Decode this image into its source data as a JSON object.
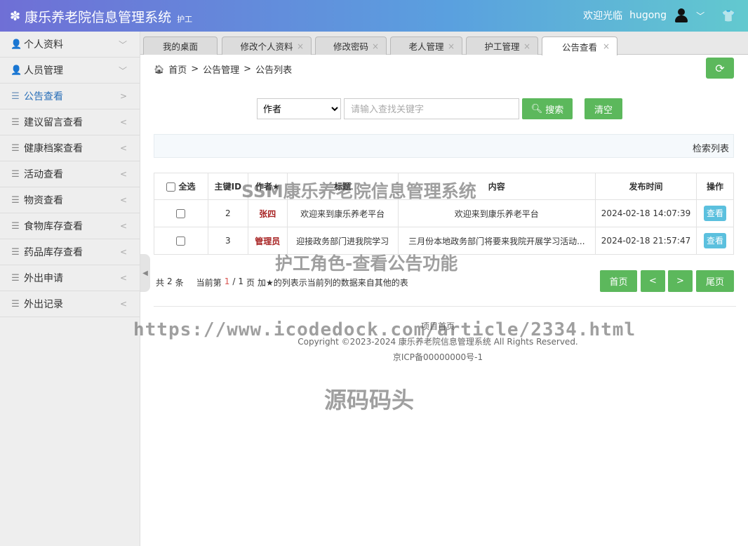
{
  "header": {
    "title": "康乐养老院信息管理系统",
    "role": "护工",
    "welcome": "欢迎光临",
    "username": "hugong"
  },
  "sidebar": {
    "items": [
      {
        "label": "个人资料",
        "icon": "user-icon",
        "arrow": "﹀"
      },
      {
        "label": "人员管理",
        "icon": "user-icon",
        "arrow": "﹀"
      },
      {
        "label": "公告查看",
        "icon": "list-icon",
        "arrow": ">"
      },
      {
        "label": "建议留言查看",
        "icon": "list-icon",
        "arrow": "<"
      },
      {
        "label": "健康档案查看",
        "icon": "list-icon",
        "arrow": "<"
      },
      {
        "label": "活动查看",
        "icon": "list-icon",
        "arrow": "<"
      },
      {
        "label": "物资查看",
        "icon": "list-icon",
        "arrow": "<"
      },
      {
        "label": "食物库存查看",
        "icon": "list-icon",
        "arrow": "<"
      },
      {
        "label": "药品库存查看",
        "icon": "list-icon",
        "arrow": "<"
      },
      {
        "label": "外出申请",
        "icon": "list-icon",
        "arrow": "<"
      },
      {
        "label": "外出记录",
        "icon": "list-icon",
        "arrow": "<"
      }
    ]
  },
  "tabs": [
    {
      "label": "我的桌面"
    },
    {
      "label": "修改个人资料"
    },
    {
      "label": "修改密码"
    },
    {
      "label": "老人管理"
    },
    {
      "label": "护工管理"
    },
    {
      "label": "公告查看"
    }
  ],
  "breadcrumb": {
    "home": "首页",
    "sep": ">",
    "level1": "公告管理",
    "level2": "公告列表"
  },
  "search": {
    "field_selected": "作者",
    "placeholder": "请输入查找关键字",
    "search_label": "搜索",
    "clear_label": "清空"
  },
  "panel_title": "检索列表",
  "table": {
    "headers": {
      "select_all": "全选",
      "id": "主键ID",
      "author": "作者★",
      "title": "标题",
      "content": "内容",
      "time": "发布时间",
      "action": "操作"
    },
    "rows": [
      {
        "id": "2",
        "author": "张四",
        "title": "欢迎来到康乐养老平台",
        "content": "欢迎来到康乐养老平台",
        "time": "2024-02-18 14:07:39",
        "action": "查看"
      },
      {
        "id": "3",
        "author": "管理员",
        "title": "迎接政务部门进我院学习",
        "content": "三月份本地政务部门将要来我院开展学习活动...",
        "time": "2024-02-18 21:57:47",
        "action": "查看"
      }
    ]
  },
  "pager": {
    "total_prefix": "共",
    "total": "2",
    "total_suffix": "条",
    "current_prefix": "当前第",
    "current": "1",
    "sep": "/",
    "pages": "1",
    "pages_suffix": "页",
    "note": "加★的列表示当前列的数据来自其他的表",
    "first": "首页",
    "prev": "<",
    "next": ">",
    "last": "尾页"
  },
  "footer": {
    "home_link": "项目首页",
    "copyright": "Copyright ©2023-2024 康乐养老院信息管理系统 All Rights Reserved.",
    "icp": "京ICP备00000000号-1"
  },
  "watermarks": {
    "w1": "SSM康乐养老院信息管理系统",
    "w2": "护工角色-查看公告功能",
    "w3": "https://www.icodedock.com/article/2334.html",
    "w4": "源码码头"
  },
  "colors": {
    "accent_green": "#5cb85c",
    "view_button": "#5bc0de",
    "author_red": "#a82424",
    "active_menu": "#2a6fb8"
  }
}
